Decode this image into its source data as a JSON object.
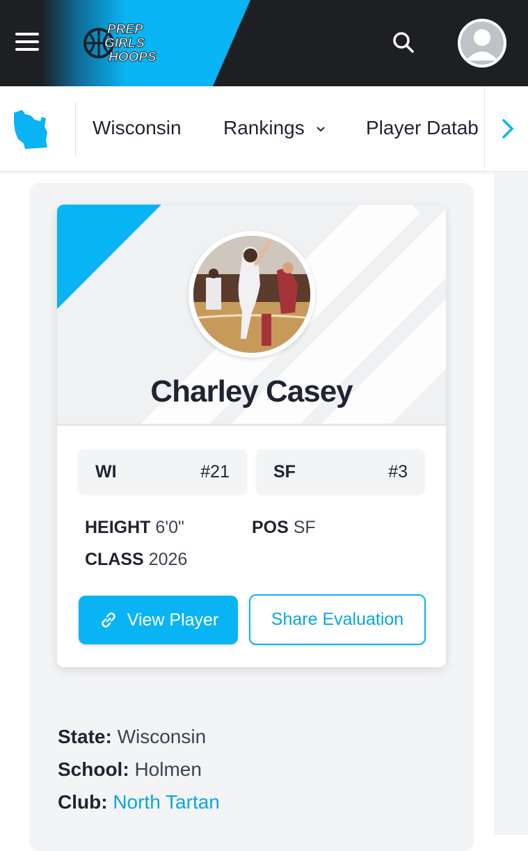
{
  "header": {
    "logo_lines": [
      "PREP",
      "GIRLS",
      "HOOPS"
    ],
    "brand_color": "#08b4f3",
    "icons": [
      "hamburger-menu-icon",
      "prep-girls-hoops-logo",
      "search-icon",
      "user-avatar-icon"
    ]
  },
  "subnav": {
    "state_icon": "wisconsin-state-icon",
    "items": [
      {
        "label": "Wisconsin"
      },
      {
        "label": "Rankings",
        "has_dropdown": true
      },
      {
        "label": "Player Datab"
      }
    ],
    "next_icon": "chevron-right-icon"
  },
  "player": {
    "name": "Charley Casey",
    "rankings": [
      {
        "label": "WI",
        "value": "#21"
      },
      {
        "label": "SF",
        "value": "#3"
      }
    ],
    "height_label": "HEIGHT",
    "height_value": "6'0\"",
    "pos_label": "POS",
    "pos_value": "SF",
    "class_label": "CLASS",
    "class_value": "2026",
    "view_button": "View Player",
    "share_button": "Share Evaluation"
  },
  "info": {
    "state_label": "State:",
    "state_value": "Wisconsin",
    "school_label": "School:",
    "school_value": "Holmen",
    "club_label": "Club:",
    "club_value": "North Tartan"
  }
}
